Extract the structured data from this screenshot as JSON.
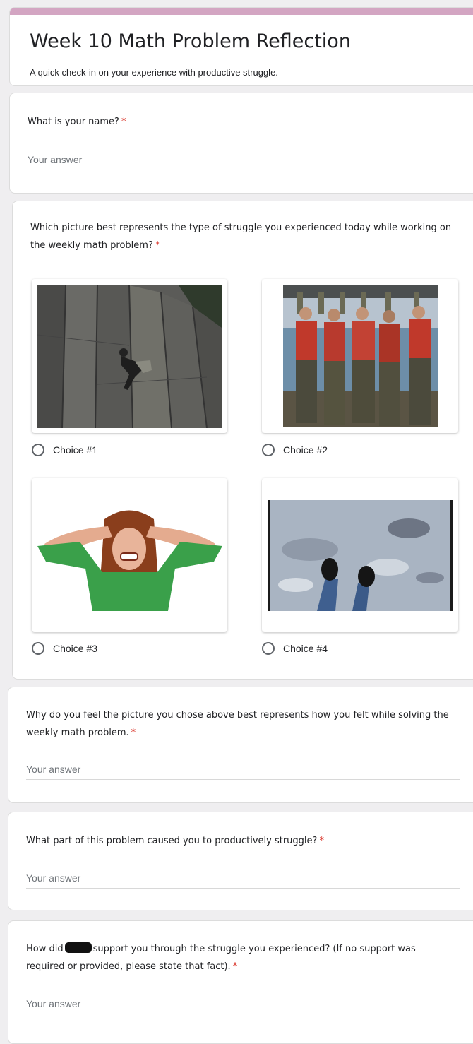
{
  "form": {
    "title": "Week 10 Math Problem Reflection",
    "description": "A quick check-in on your experience with productive struggle.",
    "accent_color": "#d3a5c2"
  },
  "questions": {
    "name": {
      "label": "What is your name?",
      "required_mark": "*",
      "placeholder": "Your answer"
    },
    "picture": {
      "label": "Which picture best represents the type of struggle you experienced today while working on the weekly math problem?",
      "required_mark": "*",
      "choices": [
        {
          "label": "Choice #1",
          "image": "rock-climber"
        },
        {
          "label": "Choice #2",
          "image": "soldiers-lifting-log"
        },
        {
          "label": "Choice #3",
          "image": "frustrated-woman"
        },
        {
          "label": "Choice #4",
          "image": "feet-on-ice"
        }
      ]
    },
    "why": {
      "label": "Why do you feel the picture you chose above best represents how you felt while solving the weekly math problem.",
      "required_mark": "*",
      "placeholder": "Your answer"
    },
    "part": {
      "label": "What part of this problem caused you to productively struggle?",
      "required_mark": "*",
      "placeholder": "Your answer"
    },
    "support": {
      "label_before": "How did",
      "label_after": "support you through the struggle you experienced? (If no support was required or provided, please state that fact).",
      "required_mark": "*",
      "placeholder": "Your answer"
    }
  }
}
